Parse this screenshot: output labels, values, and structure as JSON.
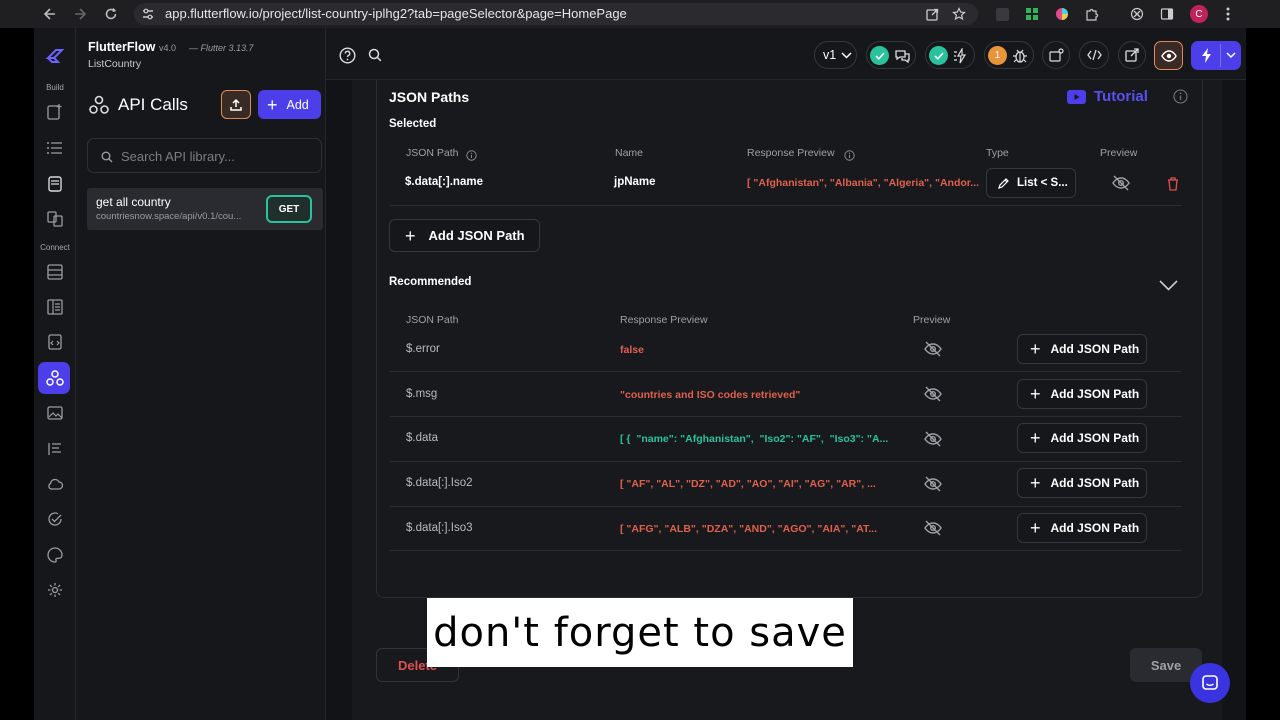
{
  "browser": {
    "url": "app.flutterflow.io/project/list-country-iplhg2?tab=pageSelector&page=HomePage",
    "avatar_letter": "C"
  },
  "app": {
    "name": "FlutterFlow",
    "version": "v4.0",
    "flutter_version": "— Flutter 3.13.7",
    "project_name": "ListCountry",
    "rail_section_build": "Build",
    "rail_section_connect": "Connect"
  },
  "toolbar": {
    "version_select": "v1",
    "warning_count": "1"
  },
  "sidebar": {
    "title": "API Calls",
    "add_label": "Add",
    "search_placeholder": "Search API library...",
    "api_item": {
      "name": "get all country",
      "url": "countriesnow.space/api/v0.1/cou...",
      "method": "GET"
    }
  },
  "json_paths": {
    "title": "JSON Paths",
    "tutorial_label": "Tutorial",
    "selected_label": "Selected",
    "selected_headers": {
      "json_path": "JSON Path",
      "name": "Name",
      "response_preview": "Response Preview",
      "type": "Type",
      "preview": "Preview"
    },
    "selected_row": {
      "path": "$.data[:].name",
      "name": "jpName",
      "response": "[ \"Afghanistan\", \"Albania\", \"Algeria\", \"Andor...",
      "type": "List < S..."
    },
    "add_json_path_label": "Add JSON Path",
    "recommended_label": "Recommended",
    "recommended_headers": {
      "json_path": "JSON Path",
      "response_preview": "Response Preview",
      "preview": "Preview"
    },
    "recommended_rows": [
      {
        "path": "$.error",
        "response": "false",
        "action": "Add JSON Path"
      },
      {
        "path": "$.msg",
        "response": "\"countries and ISO codes retrieved\"",
        "action": "Add JSON Path"
      },
      {
        "path": "$.data",
        "response": "[ {  \"name\": \"Afghanistan\",  \"Iso2\": \"AF\",  \"Iso3\": \"A...",
        "action": "Add JSON Path"
      },
      {
        "path": "$.data[:].Iso2",
        "response": "[ \"AF\", \"AL\", \"DZ\", \"AD\", \"AO\", \"AI\", \"AG\", \"AR\", ...",
        "action": "Add JSON Path"
      },
      {
        "path": "$.data[:].Iso3",
        "response": "[ \"AFG\", \"ALB\", \"DZA\", \"AND\", \"AGO\", \"AIA\", \"AT...",
        "action": "Add JSON Path"
      }
    ]
  },
  "footer": {
    "delete_label": "Delete",
    "save_label": "Save"
  },
  "caption": "don't forget to save",
  "colors": {
    "accent": "#4c3ee8",
    "green": "#29c29c",
    "error_red": "#e0604e",
    "warning_orange": "#e8953a",
    "upload_orange": "#e08a5e"
  }
}
